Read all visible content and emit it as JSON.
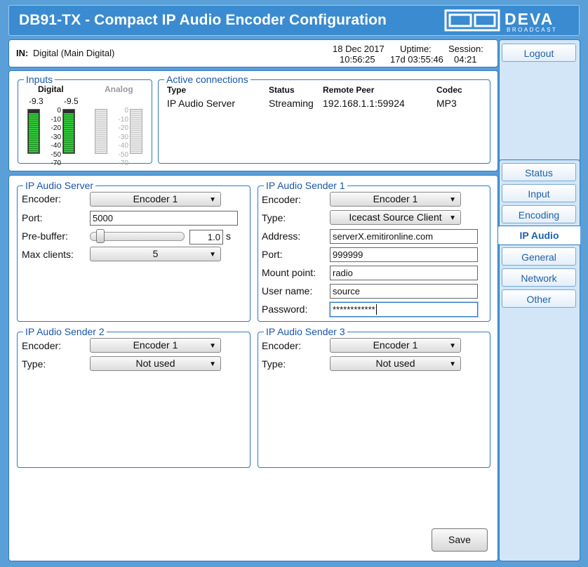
{
  "header": {
    "title": "DB91-TX - Compact IP Audio Encoder Configuration",
    "logo_text": "DEVA",
    "logo_subtext": "BROADCAST"
  },
  "infobar": {
    "input_label": "IN:",
    "input_value": "Digital (Main Digital)",
    "date": "18 Dec 2017",
    "time": "10:56:25",
    "uptime_label": "Uptime:",
    "uptime_value": "17d 03:55:46",
    "session_label": "Session:",
    "session_value": "04:21"
  },
  "auth": {
    "logout_label": "Logout"
  },
  "nav": {
    "items": [
      {
        "label": "Status",
        "active": false
      },
      {
        "label": "Input",
        "active": false
      },
      {
        "label": "Encoding",
        "active": false
      },
      {
        "label": "IP Audio",
        "active": true
      },
      {
        "label": "General",
        "active": false
      },
      {
        "label": "Network",
        "active": false
      },
      {
        "label": "Other",
        "active": false
      }
    ]
  },
  "inputs": {
    "legend": "Inputs",
    "digital_label": "Digital",
    "analog_label": "Analog",
    "digital_left_level": "-9.3",
    "digital_right_level": "-9.5",
    "scale_ticks": [
      "0",
      "-10",
      "-20",
      "-30",
      "-40",
      "-50",
      "-70"
    ]
  },
  "connections": {
    "legend": "Active connections",
    "columns": [
      "Type",
      "Status",
      "Remote Peer",
      "Codec"
    ],
    "rows": [
      [
        "IP Audio Server",
        "Streaming",
        "192.168.1.1:59924",
        "MP3"
      ]
    ]
  },
  "server": {
    "legend": "IP Audio Server",
    "encoder_label": "Encoder:",
    "encoder_value": "Encoder 1",
    "port_label": "Port:",
    "port_value": "5000",
    "prebuffer_label": "Pre-buffer:",
    "prebuffer_value": "1.0",
    "prebuffer_unit": "s",
    "maxclients_label": "Max clients:",
    "maxclients_value": "5"
  },
  "sender1": {
    "legend": "IP Audio Sender 1",
    "encoder_label": "Encoder:",
    "encoder_value": "Encoder 1",
    "type_label": "Type:",
    "type_value": "Icecast Source Client",
    "address_label": "Address:",
    "address_value": "serverX.emitironline.com",
    "port_label": "Port:",
    "port_value": "999999",
    "mount_label": "Mount point:",
    "mount_value": "radio",
    "user_label": "User name:",
    "user_value": "source",
    "password_label": "Password:",
    "password_value": "************"
  },
  "sender2": {
    "legend": "IP Audio Sender 2",
    "encoder_label": "Encoder:",
    "encoder_value": "Encoder 1",
    "type_label": "Type:",
    "type_value": "Not used"
  },
  "sender3": {
    "legend": "IP Audio Sender 3",
    "encoder_label": "Encoder:",
    "encoder_value": "Encoder 1",
    "type_label": "Type:",
    "type_value": "Not used"
  },
  "actions": {
    "save_label": "Save"
  }
}
